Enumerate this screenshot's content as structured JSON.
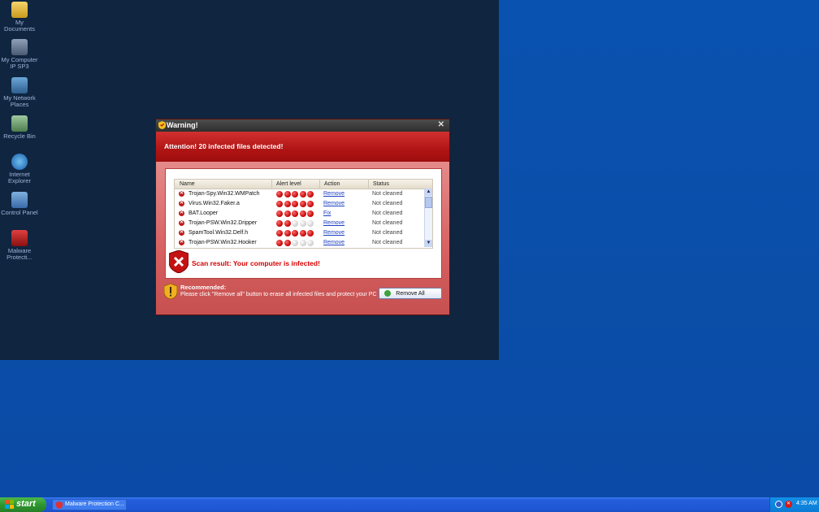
{
  "desktop": {
    "icons": [
      {
        "label": "My Documents",
        "icon": "folder-icon"
      },
      {
        "label": "My Computer\nIP SP3",
        "icon": "computer-icon"
      },
      {
        "label": "My Network\nPlaces",
        "icon": "network-icon"
      },
      {
        "label": "Recycle Bin",
        "icon": "recycle-bin-icon"
      },
      {
        "label": "Internet\nExplorer",
        "icon": "ie-icon"
      },
      {
        "label": "Control Panel",
        "icon": "control-panel-icon"
      },
      {
        "label": "Malware\nProtecti...",
        "icon": "malware-shield-icon"
      }
    ]
  },
  "dialog": {
    "title": "Warning!",
    "close_label": "✕",
    "banner": "Attention! 20 infected files detected!",
    "table": {
      "headers": [
        "Name",
        "Alert level",
        "Action",
        "Status"
      ],
      "rows": [
        {
          "name": "Trojan-Spy.Win32.WMPatch",
          "level": 5,
          "action": "Remove",
          "status": "Not cleaned"
        },
        {
          "name": "Virus.Win32.Faker.a",
          "level": 5,
          "action": "Remove",
          "status": "Not cleaned"
        },
        {
          "name": "BAT.Looper",
          "level": 5,
          "action": "Fix",
          "status": "Not cleaned"
        },
        {
          "name": "Trojan-PSW.Win32.Dripper",
          "level": 2,
          "action": "Remove",
          "status": "Not cleaned"
        },
        {
          "name": "SpamTool.Win32.Delf.h",
          "level": 5,
          "action": "Remove",
          "status": "Not cleaned"
        },
        {
          "name": "Trojan-PSW.Win32.Hooker",
          "level": 2,
          "action": "Remove",
          "status": "Not cleaned"
        }
      ]
    },
    "scan_result": "Scan result: Your computer is infected!",
    "recommended_title": "Recommended:",
    "recommended_text": "Please click \"Remove all\" button to erase all infected files and protect your PC",
    "remove_all_label": "Remove All"
  },
  "taskbar": {
    "start_label": "start",
    "task_label": "Malware Protection C...",
    "clock": "4:35 AM"
  },
  "colors": {
    "alert_red": "#c00000",
    "banner_red": "#b01414",
    "link_blue": "#1a3fc0"
  }
}
